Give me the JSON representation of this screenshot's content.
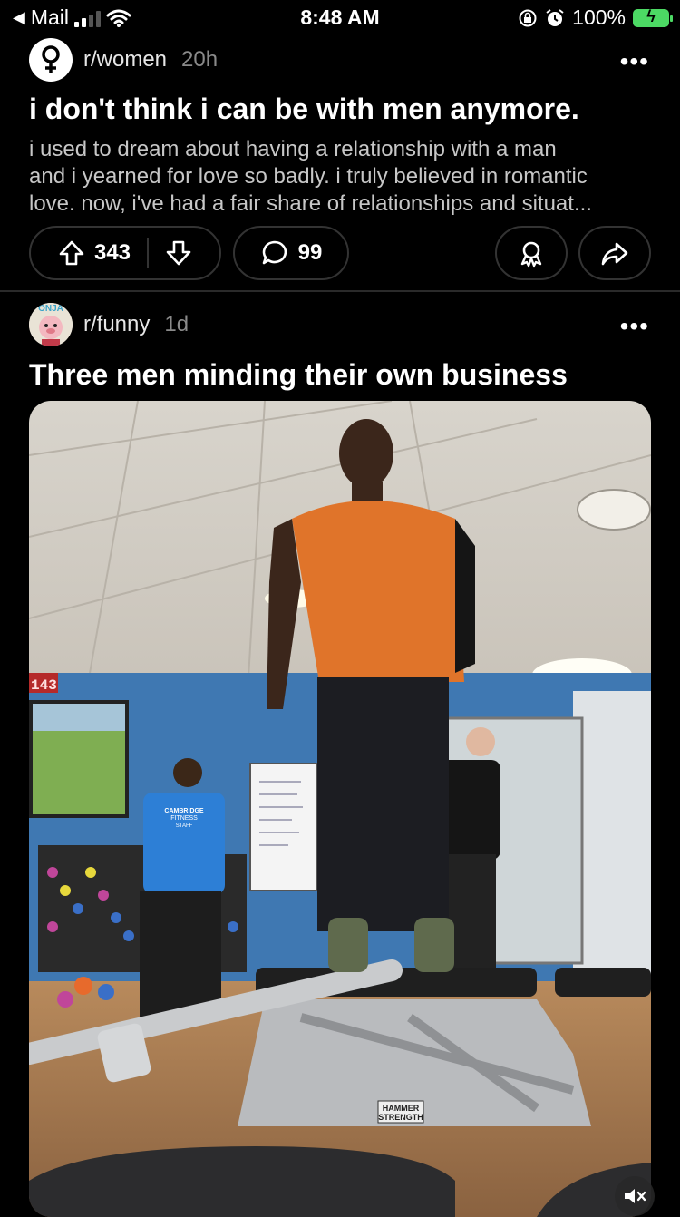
{
  "status_bar": {
    "back_app": "Mail",
    "time": "8:48 AM",
    "battery": "100%"
  },
  "post1": {
    "subreddit": "r/women",
    "age": "20h",
    "title": "i don't think i can be with men anymore.",
    "body_line1": "i used to dream about having a relationship with a man",
    "body_line2": "and i yearned for love so badly. i truly believed in romantic",
    "body_line3": "love. now, i've had a fair share of relationships and situat...",
    "upvotes": "343",
    "comments": "99"
  },
  "post2": {
    "subreddit": "r/funny",
    "age": "1d",
    "title": "Three men minding their own business",
    "avatar_text": "ONJA",
    "media": {
      "scoreboard": "143",
      "shirt_text_1": "CAMBRIDGE",
      "shirt_text_2": "FITNESS",
      "shirt_text_3": "STAFF",
      "bench_brand_1": "HAMMER",
      "bench_brand_2": "STRENGTH"
    }
  },
  "colors": {
    "background": "#000000",
    "pill_border": "#333333",
    "battery_green": "#4cd964",
    "muted_text": "#8a8a8a"
  }
}
